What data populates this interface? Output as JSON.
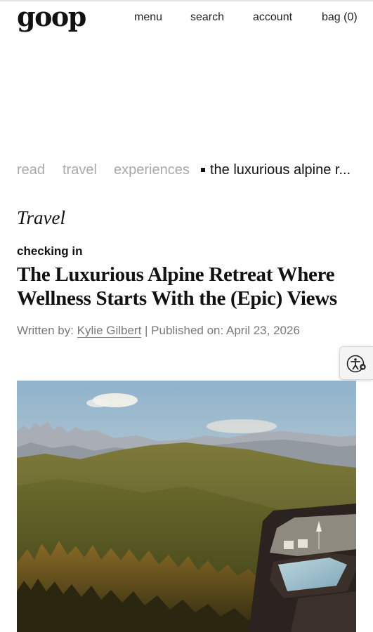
{
  "header": {
    "logo": "goop",
    "nav": {
      "menu": "menu",
      "search": "search",
      "account": "account",
      "bag": "bag (0)"
    }
  },
  "breadcrumb": {
    "items": [
      "read",
      "travel",
      "experiences"
    ],
    "current": "the luxurious alpine r..."
  },
  "article": {
    "category": "Travel",
    "kicker": "checking in",
    "headline": "The Luxurious Alpine Retreat Where Wellness Starts With the (Epic) Views",
    "byline_prefix": "Written by:",
    "author": "Kylie Gilbert",
    "published": "| Published on: April 23, 2026"
  },
  "icons": {
    "accessibility": "accessibility-icon"
  },
  "colors": {
    "muted_text": "#a9a9a9",
    "byline_text": "#7a7a7a",
    "text": "#111111"
  }
}
